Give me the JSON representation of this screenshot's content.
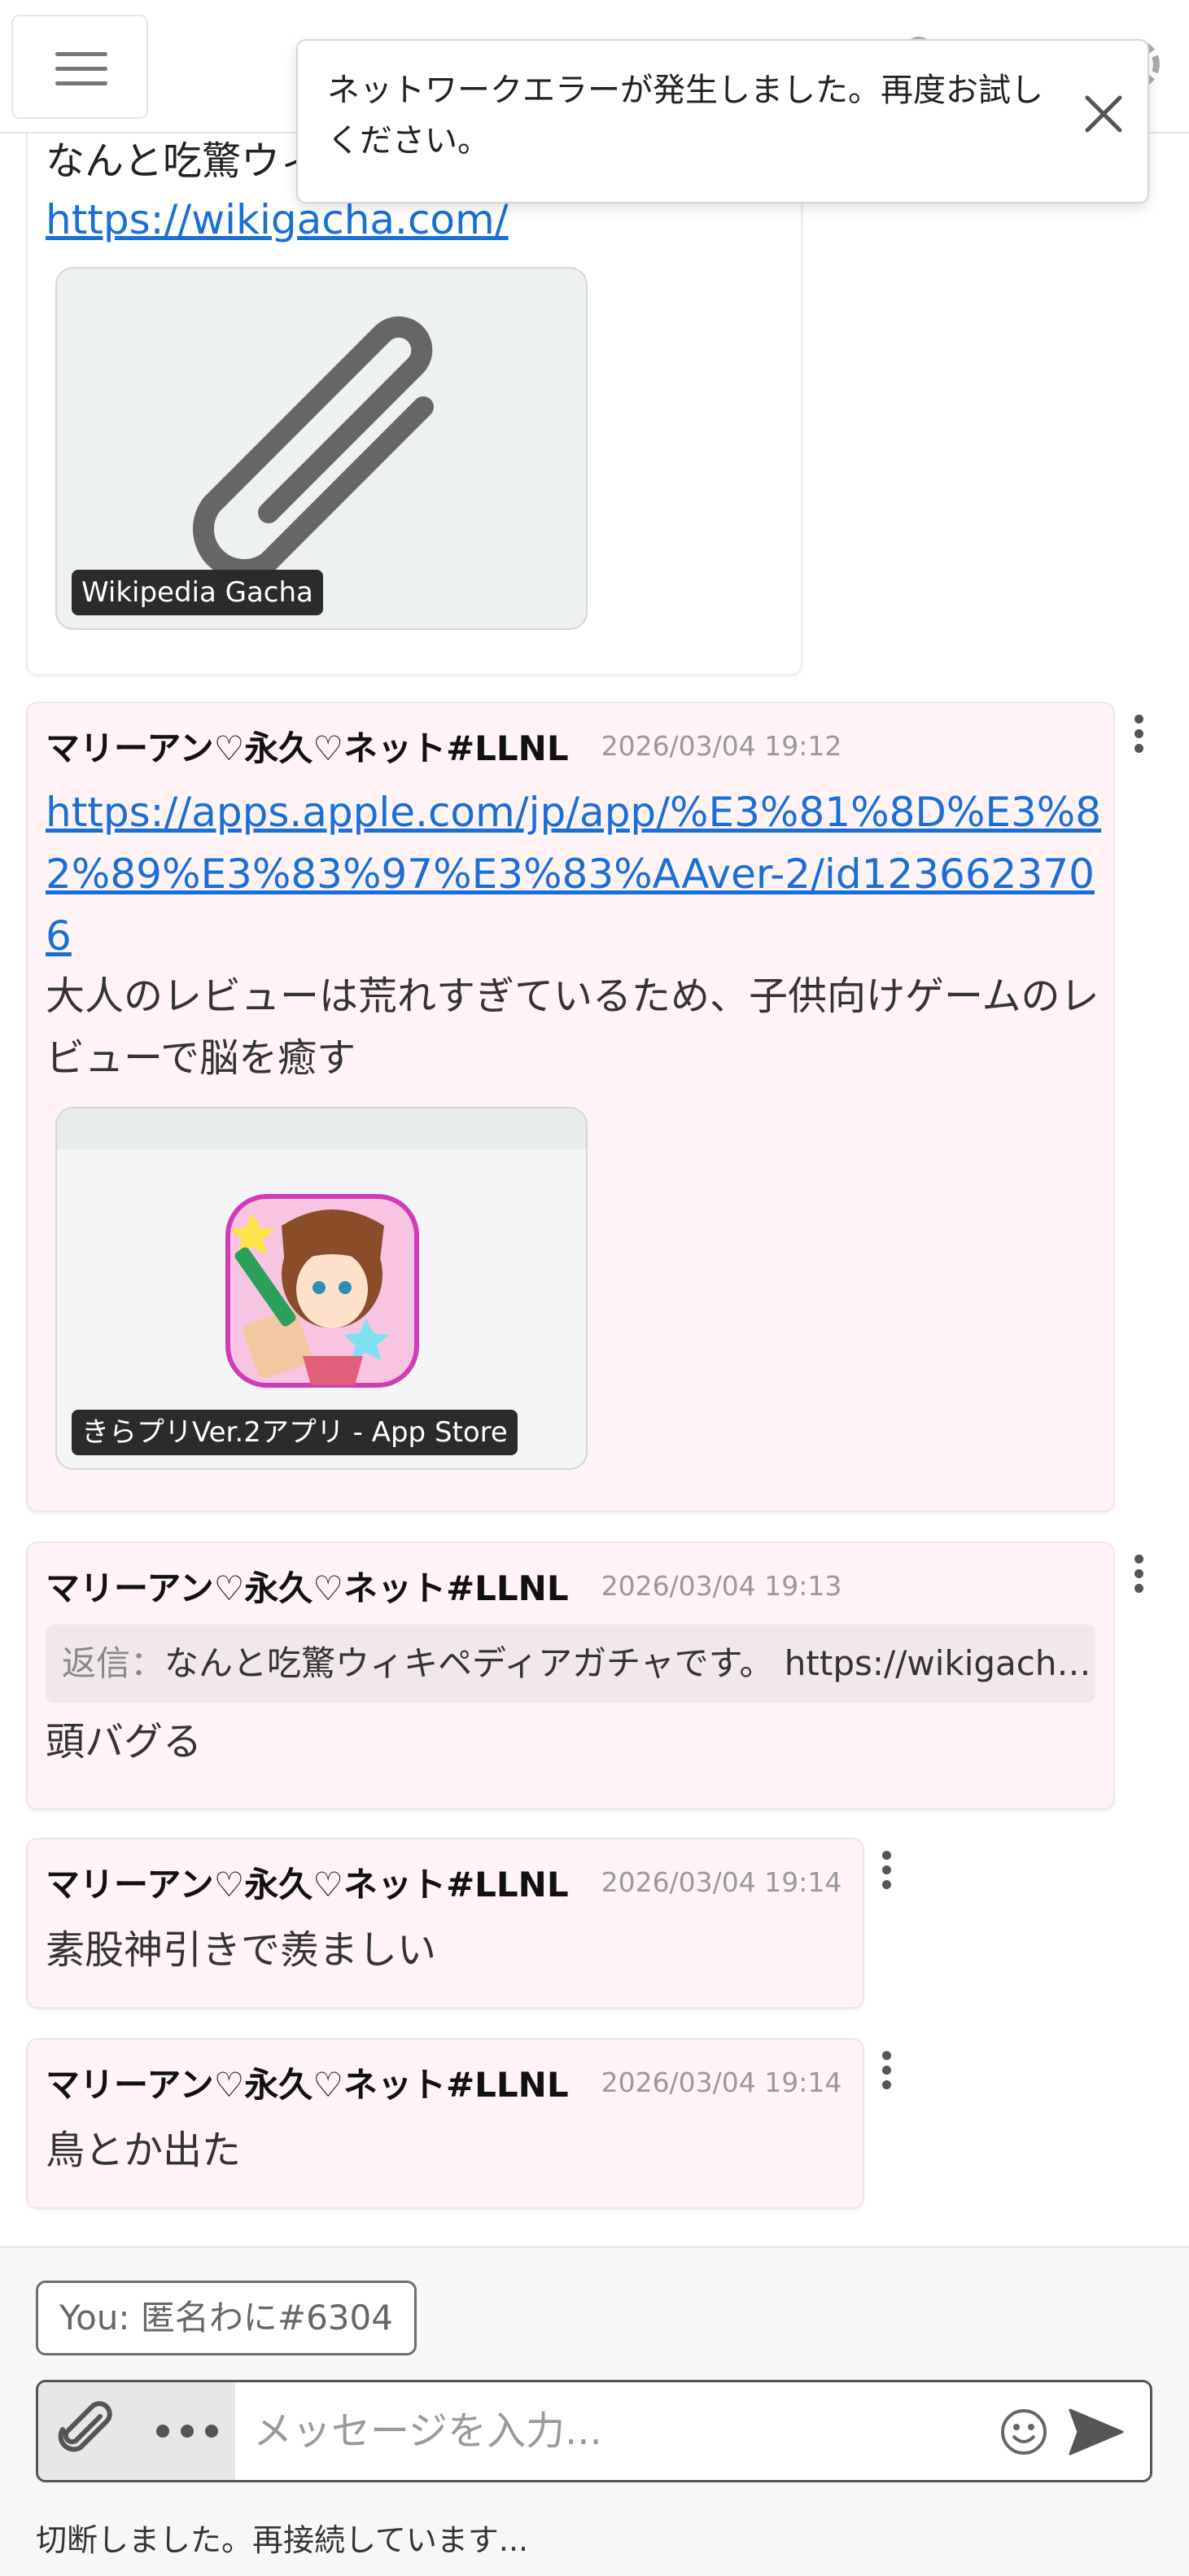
{
  "toast": {
    "message": "ネットワークエラーが発生しました。再度お試しください。"
  },
  "messages": [
    {
      "text_top": "なんと吃驚ウィキペディアガチャです。",
      "link": "https://wikigacha.com/",
      "preview_label": "Wikipedia Gacha"
    },
    {
      "author": "マリーアン♡永久♡ネット#LLNL",
      "time": "2026/03/04 19:12",
      "link": "https://apps.apple.com/jp/app/%E3%81%8D%E3%82%89%E3%83%97%E3%83%AAver-2/id1236623706",
      "text": "大人のレビューは荒れすぎているため、子供向けゲームのレビューで脳を癒す",
      "preview_label": "きらプリVer.2アプリ - App Store"
    },
    {
      "author": "マリーアン♡永久♡ネット#LLNL",
      "time": "2026/03/04 19:13",
      "reply_label": "返信：",
      "reply_text": "なんと吃驚ウィキペディアガチャです。 https://wikigacha.com/",
      "text": "頭バグる"
    },
    {
      "author": "マリーアン♡永久♡ネット#LLNL",
      "time": "2026/03/04 19:14",
      "text": "素股神引きで羨ましい"
    },
    {
      "author": "マリーアン♡永久♡ネット#LLNL",
      "time": "2026/03/04 19:14",
      "text": "鳥とか出た"
    }
  ],
  "composer": {
    "identity": "You: 匿名わに#6304",
    "placeholder": "メッセージを入力...",
    "status": "切断しました。再接続しています..."
  },
  "icons": {
    "menu": "hamburger-icon",
    "header": [
      "user-icon",
      "link-icon",
      "search-icon",
      "gear-icon"
    ],
    "close": "close-icon",
    "attach": "paperclip-icon",
    "more": "more-dots-icon",
    "emoji": "smiley-icon",
    "send": "send-icon"
  },
  "colors": {
    "link": "#1a6fd6",
    "bubble": "#fff3f6"
  }
}
